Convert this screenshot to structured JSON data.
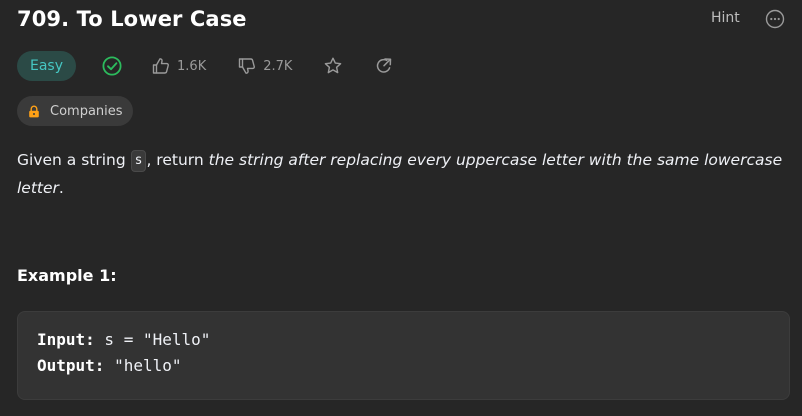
{
  "problem": {
    "title": "709. To Lower Case",
    "hint_label": "Hint",
    "difficulty": "Easy",
    "likes": "1.6K",
    "dislikes": "2.7K",
    "companies_label": "Companies"
  },
  "icons": {
    "more": "more-horizontal-icon",
    "solved": "check-circle-icon",
    "like": "thumbs-up-icon",
    "dislike": "thumbs-down-icon",
    "favorite": "star-icon",
    "share": "share-icon",
    "lock": "lock-icon"
  },
  "colors": {
    "background": "#262626",
    "easy_text": "#46c6c2",
    "easy_bg": "#2b4a46",
    "solved_green": "#2cbb5d",
    "lock_orange": "#ffa116"
  },
  "description": {
    "prefix": "Given a string ",
    "code": "s",
    "middle": ", return ",
    "emphasis": "the string after replacing every uppercase letter with the same lowercase letter",
    "suffix": "."
  },
  "example": {
    "title": "Example 1:",
    "input_label": "Input:",
    "input_value": " s = \"Hello\"",
    "output_label": "Output:",
    "output_value": " \"hello\""
  }
}
